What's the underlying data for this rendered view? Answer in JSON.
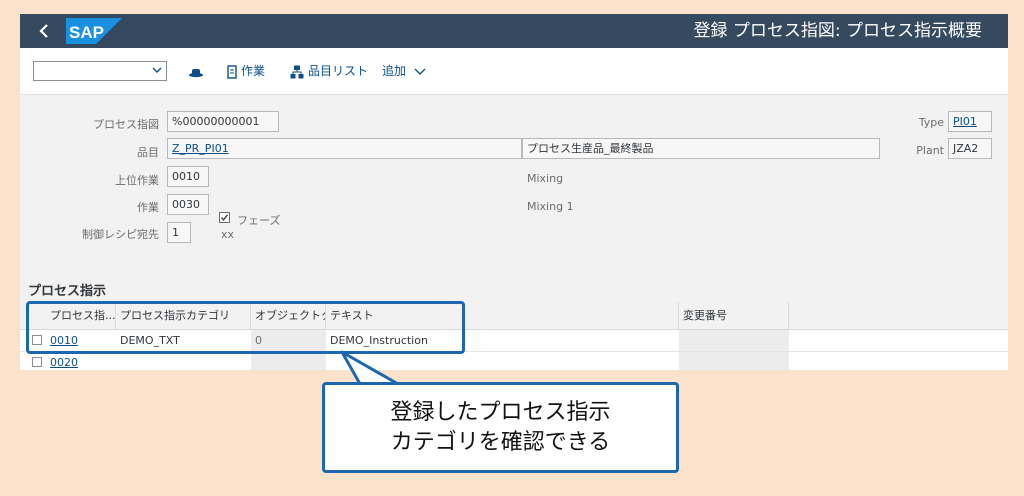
{
  "shell": {
    "back_icon": "chevron-left-icon",
    "logo_text": "SAP",
    "logo_color": "#1b8fe0",
    "bar_color": "#354a5f",
    "title": "登録 プロセス指図: プロセス指示概要"
  },
  "toolbar": {
    "variant_value": "",
    "hat_icon": "hat-icon",
    "operation_label": "作業",
    "material_list_label": "品目リスト",
    "add_label": "追加"
  },
  "form": {
    "order_label": "プロセス指図",
    "order_value": "%00000000001",
    "material_label": "品目",
    "material_value": "Z_PR_PI01",
    "material_desc": "プロセス生産品_最終製品",
    "parent_op_label": "上位作業",
    "parent_op_value": "0010",
    "parent_op_desc": "Mixing",
    "op_label": "作業",
    "op_value": "0030",
    "phase_label": "フェーズ",
    "phase_checked": true,
    "op_desc": "Mixing 1",
    "recipe_dest_label": "制御レシピ宛先",
    "recipe_dest_value": "1",
    "recipe_dest_desc": "xx",
    "type_label": "Type",
    "type_value": "PI01",
    "plant_label": "Plant",
    "plant_value": "JZA2"
  },
  "table": {
    "section_title": "プロセス指示",
    "columns": [
      "プロセス指...",
      "プロセス指示カテゴリ",
      "オブジェクトタ...",
      "テキスト",
      "変更番号"
    ],
    "rows": [
      {
        "id": "0010",
        "category": "DEMO_TXT",
        "object_type": "0",
        "text": "DEMO_Instruction",
        "change_no": ""
      },
      {
        "id": "0020",
        "category": "",
        "object_type": "",
        "text": "",
        "change_no": ""
      }
    ]
  },
  "annotation": {
    "callout_text": "登録したプロセス指示\nカテゴリを確認できる",
    "accent_color": "#1b67b0",
    "background_color": "#fbe3cb"
  }
}
